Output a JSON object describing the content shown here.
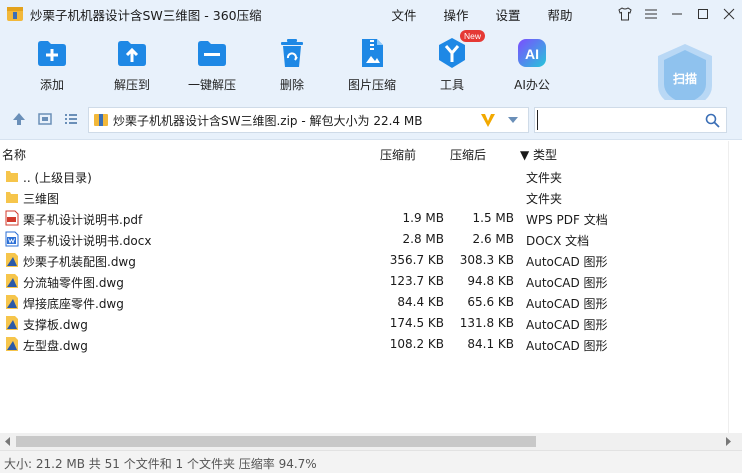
{
  "titlebar": {
    "title": "炒栗子机机器设计含SW三维图 - 360压缩",
    "menu": [
      "文件",
      "操作",
      "设置",
      "帮助"
    ]
  },
  "toolbar": {
    "tools": [
      {
        "label": "添加",
        "icon": "add-archive-icon"
      },
      {
        "label": "解压到",
        "icon": "extract-to-icon"
      },
      {
        "label": "一键解压",
        "icon": "one-click-extract-icon"
      },
      {
        "label": "删除",
        "icon": "delete-icon"
      },
      {
        "label": "图片压缩",
        "icon": "image-compress-icon"
      },
      {
        "label": "工具",
        "icon": "tools-icon"
      },
      {
        "label": "AI办公",
        "icon": "ai-office-icon"
      }
    ],
    "new_badge": "New",
    "ai_icon_text": "AI",
    "scan_label": "扫描"
  },
  "address": {
    "path": "炒栗子机机器设计含SW三维图.zip - 解包大小为 22.4 MB",
    "search_placeholder": ""
  },
  "columns": {
    "name": "名称",
    "before": "压缩前",
    "after": "压缩后",
    "type": "▼ 类型"
  },
  "files": [
    {
      "name": ".. (上级目录)",
      "before": "",
      "after": "",
      "type": "文件夹",
      "icon": "folder-icon"
    },
    {
      "name": "三维图",
      "before": "",
      "after": "",
      "type": "文件夹",
      "icon": "folder-icon"
    },
    {
      "name": "栗子机设计说明书.pdf",
      "before": "1.9 MB",
      "after": "1.5 MB",
      "type": "WPS PDF 文档",
      "icon": "pdf-icon"
    },
    {
      "name": "栗子机设计说明书.docx",
      "before": "2.8 MB",
      "after": "2.6 MB",
      "type": "DOCX 文档",
      "icon": "docx-icon"
    },
    {
      "name": "炒栗子机装配图.dwg",
      "before": "356.7 KB",
      "after": "308.3 KB",
      "type": "AutoCAD 图形",
      "icon": "dwg-icon"
    },
    {
      "name": "分流轴零件图.dwg",
      "before": "123.7 KB",
      "after": "94.8 KB",
      "type": "AutoCAD 图形",
      "icon": "dwg-icon"
    },
    {
      "name": "焊接底座零件.dwg",
      "before": "84.4 KB",
      "after": "65.6 KB",
      "type": "AutoCAD 图形",
      "icon": "dwg-icon"
    },
    {
      "name": "支撑板.dwg",
      "before": "174.5 KB",
      "after": "131.8 KB",
      "type": "AutoCAD 图形",
      "icon": "dwg-icon"
    },
    {
      "name": "左型盘.dwg",
      "before": "108.2 KB",
      "after": "84.1 KB",
      "type": "AutoCAD 图形",
      "icon": "dwg-icon"
    }
  ],
  "status": {
    "text": "大小: 21.2 MB 共 51 个文件和 1 个文件夹 压缩率 94.7%"
  },
  "colors": {
    "accent": "#1e88e5",
    "title_bg": "#e8f1fb",
    "folder": "#f6c54b"
  }
}
